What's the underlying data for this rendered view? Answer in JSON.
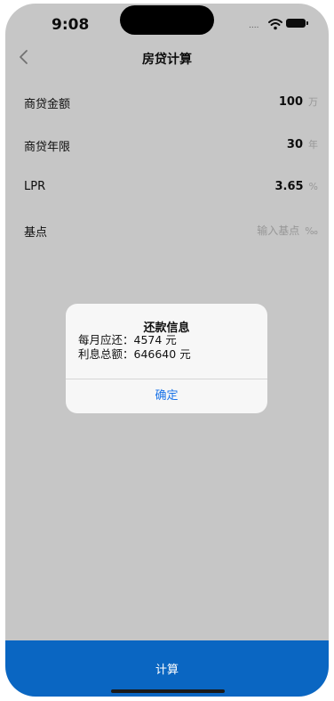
{
  "status_bar": {
    "time": "9:08",
    "signal_dots": "....",
    "icons": [
      "wifi-icon",
      "battery-icon"
    ]
  },
  "nav": {
    "title": "房贷计算",
    "back_icon": "chevron-left-icon"
  },
  "form": {
    "rows": [
      {
        "label": "商贷金额",
        "value": "100",
        "placeholder": "",
        "unit": "万"
      },
      {
        "label": "商贷年限",
        "value": "30",
        "placeholder": "",
        "unit": "年"
      },
      {
        "label": "LPR",
        "value": "3.65",
        "placeholder": "",
        "unit": "%"
      },
      {
        "label": "基点",
        "value": "",
        "placeholder": "输入基点",
        "unit": "‰"
      }
    ]
  },
  "dialog": {
    "title": "还款信息",
    "line1": "每月应还：4574 元",
    "line2": "利息总额：646640 元",
    "confirm_label": "确定"
  },
  "bottom_button": {
    "label": "计算"
  },
  "colors": {
    "accent": "#0a66c2",
    "link": "#1a73e8"
  }
}
